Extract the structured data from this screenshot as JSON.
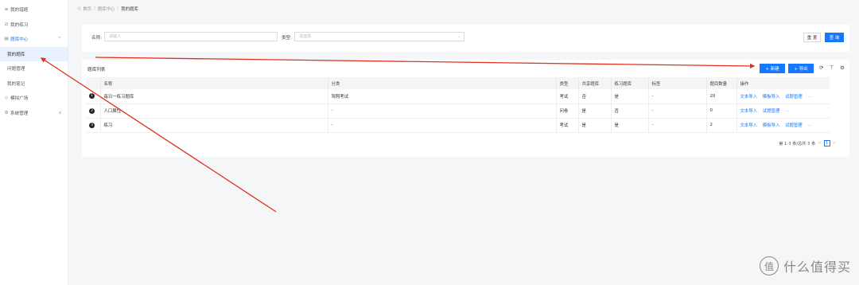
{
  "sidebar": {
    "items": [
      {
        "icon": "≡",
        "label": "我的错题",
        "type": "top"
      },
      {
        "icon": "☑",
        "label": "我的练习",
        "type": "top"
      },
      {
        "icon": "▤",
        "label": "题库中心",
        "type": "group",
        "chevron": "^"
      },
      {
        "label": "我的题库",
        "type": "sub",
        "active": true
      },
      {
        "label": "问题管理",
        "type": "sub"
      },
      {
        "label": "我的笔记",
        "type": "sub"
      },
      {
        "icon": "◇",
        "label": "模拟广场",
        "type": "top"
      },
      {
        "icon": "⚙",
        "label": "系统管理",
        "type": "top",
        "chevron": "v"
      }
    ]
  },
  "breadcrumb": {
    "back": "◁",
    "home": "首页",
    "center": "题库中心",
    "current": "我的题库"
  },
  "search": {
    "name_label": "名称:",
    "name_placeholder": "请输入",
    "type_label": "类型:",
    "type_placeholder": "请选择",
    "reset_label": "重 置",
    "query_label": "查 询"
  },
  "list": {
    "title": "题库列表",
    "new_label": "+ 新建",
    "export_label": "+ 导出",
    "columns": [
      "",
      "名称",
      "分类",
      "类型",
      "共享题库",
      "练习题库",
      "标签",
      "题目数量",
      "操作"
    ],
    "rows": [
      {
        "no": "1",
        "name": "每日一练习题库",
        "category": "驾照考试",
        "type": "考试",
        "shared": "否",
        "practice": "是",
        "tag": "-",
        "count": "20",
        "actions": [
          "文本导入",
          "模板导入",
          "试题管理"
        ],
        "more": "···"
      },
      {
        "no": "2",
        "name": "人口属性",
        "category": "-",
        "type": "问卷",
        "shared": "是",
        "practice": "否",
        "tag": "-",
        "count": "0",
        "actions": [
          "文本导入",
          "试题管理"
        ],
        "more": "···"
      },
      {
        "no": "3",
        "name": "练习",
        "category": "-",
        "type": "考试",
        "shared": "是",
        "practice": "是",
        "tag": "-",
        "count": "2",
        "actions": [
          "文本导入",
          "模板导入",
          "试题管理"
        ],
        "more": "···"
      }
    ],
    "pagination": {
      "summary": "第 1-3 条/总共 3 条",
      "prev": "<",
      "page": "1",
      "next": ">"
    }
  },
  "watermark": {
    "badge": "值",
    "text": "什么值得买"
  },
  "colors": {
    "accent": "#1677ff",
    "annotation": "#e0301e"
  }
}
